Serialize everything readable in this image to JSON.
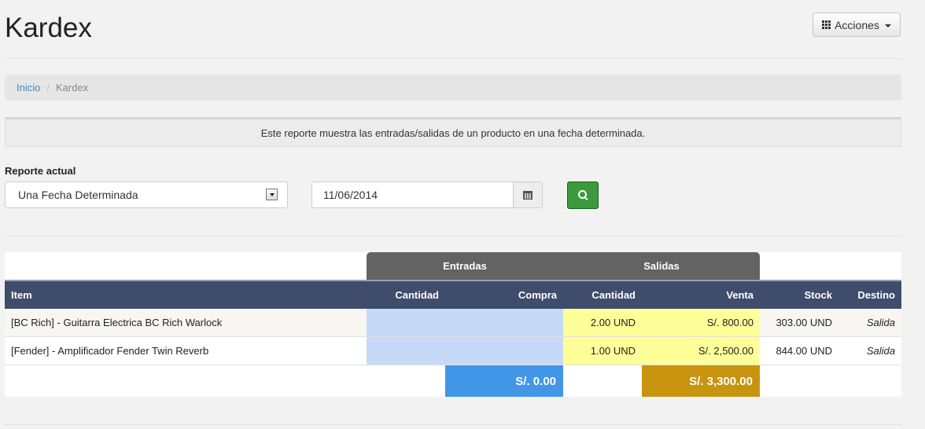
{
  "page": {
    "title": "Kardex"
  },
  "actions": {
    "label": "Acciones"
  },
  "breadcrumb": {
    "home": "Inicio",
    "current": "Kardex"
  },
  "info": {
    "text": "Este reporte muestra las entradas/salidas de un producto en una fecha determinada."
  },
  "filters": {
    "report_label": "Reporte actual",
    "report_value": "Una Fecha Determinada",
    "date_value": "11/06/2014"
  },
  "table": {
    "groups": {
      "entradas": "Entradas",
      "salidas": "Salidas"
    },
    "headers": {
      "item": "Item",
      "in_qty": "Cantidad",
      "in_buy": "Compra",
      "out_qty": "Cantidad",
      "out_sale": "Venta",
      "stock": "Stock",
      "dest": "Destino"
    },
    "rows": [
      {
        "item": "[BC Rich] - Guitarra Electrica BC Rich Warlock",
        "in_qty": "",
        "in_buy": "",
        "out_qty": "2.00 UND",
        "out_sale": "S/. 800.00",
        "stock": "303.00 UND",
        "dest": "Salida"
      },
      {
        "item": "[Fender] - Amplificador Fender Twin Reverb",
        "in_qty": "",
        "in_buy": "",
        "out_qty": "1.00 UND",
        "out_sale": "S/. 2,500.00",
        "stock": "844.00 UND",
        "dest": "Salida"
      }
    ],
    "totals": {
      "compra": "S/. 0.00",
      "venta": "S/. 3,300.00"
    }
  },
  "colors": {
    "header_bg": "#3f4c6b",
    "entradas_bg": "#c6d9f7",
    "salidas_bg": "#ffff9a",
    "total_in": "#4196e8",
    "total_out": "#c8940f",
    "search_btn": "#3c9a3c"
  }
}
